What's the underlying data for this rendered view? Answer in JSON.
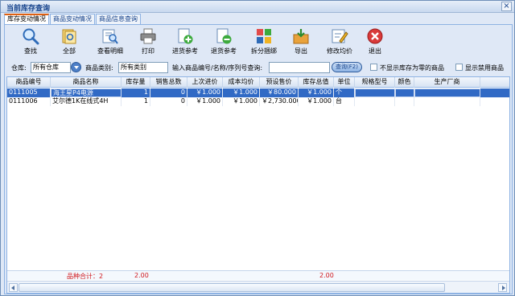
{
  "window": {
    "title": "当前库存查询",
    "close_glyph": "×"
  },
  "tabs": [
    {
      "label": "库存变动情况"
    },
    {
      "label": "商品变动情况"
    },
    {
      "label": "商品信息查询"
    }
  ],
  "toolbar": [
    {
      "label": "查找",
      "icon": "magnifier-icon"
    },
    {
      "label": "全部",
      "icon": "all-documents-icon"
    },
    {
      "label": "查看明细",
      "icon": "view-detail-icon"
    },
    {
      "label": "打印",
      "icon": "printer-icon"
    },
    {
      "label": "进货参考",
      "icon": "purchase-reference-icon"
    },
    {
      "label": "退货参考",
      "icon": "return-reference-icon"
    },
    {
      "label": "拆分捆绑",
      "icon": "split-bundle-icon"
    },
    {
      "label": "导出",
      "icon": "export-icon"
    },
    {
      "label": "修改均价",
      "icon": "edit-price-icon"
    },
    {
      "label": "退出",
      "icon": "exit-icon"
    }
  ],
  "filters": {
    "warehouse_label": "仓库:",
    "warehouse_value": "所有仓库",
    "category_label": "商品类别:",
    "category_value": "所有类别",
    "search_label": "输入商品编号/名称/序列号查询:",
    "search_value": "",
    "query_button": "查询(F2)",
    "hide_zero_label": "不显示库存为零的商品",
    "show_disabled_label": "显示禁用商品"
  },
  "columns": [
    "商品编号",
    "商品名称",
    "库存量",
    "销售总数",
    "上次进价",
    "成本均价",
    "预设售价",
    "库存总值",
    "单位",
    "规格型号",
    "颜色",
    "生产厂商"
  ],
  "rows": [
    {
      "code": "0111005",
      "name": "海王星P4电源",
      "stock": "1",
      "sold": "0",
      "last_price": "￥1.000",
      "avg_cost": "￥1.000",
      "preset_price": "￥80.000",
      "total_value": "￥1.000",
      "unit": "个",
      "spec": "",
      "color": "",
      "maker": ""
    },
    {
      "code": "0111006",
      "name": "艾尔德1K在线式4H",
      "stock": "1",
      "sold": "0",
      "last_price": "￥1.000",
      "avg_cost": "￥1.000",
      "preset_price": "￥2,730.000",
      "total_value": "￥1.000",
      "unit": "台",
      "spec": "",
      "color": "",
      "maker": ""
    }
  ],
  "footer": {
    "count_text": "品种合计：2",
    "stock_total": "2.00",
    "value_total": "2.00"
  },
  "colors": {
    "selection": "#316ac5",
    "footer_text": "#d0181e",
    "title_text": "#15428b",
    "active_tab_accent": "#e06010"
  }
}
